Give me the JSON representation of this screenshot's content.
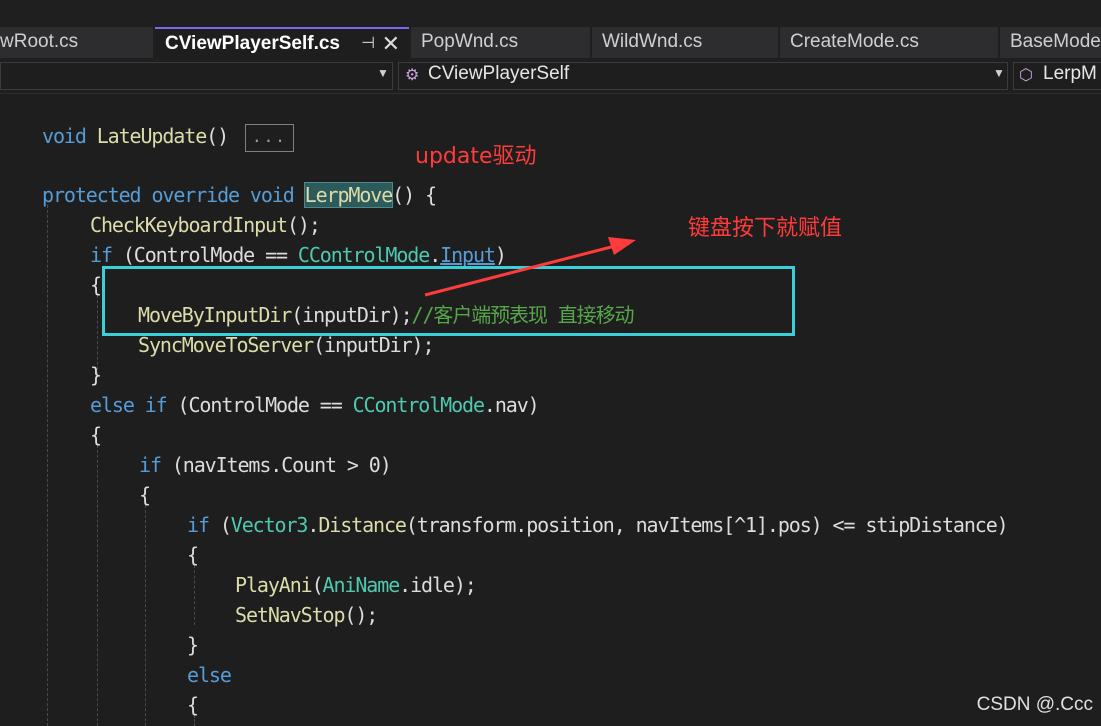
{
  "tabs": [
    {
      "label": "wRoot.cs"
    },
    {
      "label": "CViewPlayerSelf.cs",
      "pin": "⊣",
      "close": "✕"
    },
    {
      "label": "PopWnd.cs"
    },
    {
      "label": "WildWnd.cs"
    },
    {
      "label": "CreateMode.cs"
    },
    {
      "label": "BaseMode"
    }
  ],
  "navbar": {
    "class_label": "CViewPlayerSelf",
    "member_label": "LerpM"
  },
  "code": {
    "l1_kw": "void",
    "l1_fn": "LateUpdate",
    "l1_paren": "()",
    "l1_collapsed": "...",
    "l2_protected": "protected",
    "l2_override": "override",
    "l2_void": "void",
    "l2_fn": "LerpMove",
    "l2_paren": "()",
    "l2_brace": "{",
    "l3_fn": "CheckKeyboardInput",
    "l3_rest": "();",
    "l4_if": "if",
    "l4_a": " (ControlMode == ",
    "l4_type": "CControlMode",
    "l4_dot": ".",
    "l4_member": "Input",
    "l4_close": ")",
    "l5": "{",
    "l6_fn": "MoveByInputDir",
    "l6_rest": "(inputDir);",
    "l6_comment": "//客户端预表现 直接移动",
    "l7_fn": "SyncMoveToServer",
    "l7_rest": "(inputDir);",
    "l8": "}",
    "l9_else": "else",
    "l9_if": "if",
    "l9_a": " (ControlMode == ",
    "l9_type": "CControlMode",
    "l9_b": ".nav)",
    "l10": "{",
    "l11_if": "if",
    "l11_rest": " (navItems.Count > 0)",
    "l12": "{",
    "l13_if": "if",
    "l13_type": "Vector3",
    "l13_a": ".",
    "l13_fn": "Distance",
    "l13_b": "(transform.position, navItems[^1].pos) <= stipDistance)",
    "l14": "{",
    "l15_fn": "PlayAni",
    "l15_open": "(",
    "l15_type": "AniName",
    "l15_rest": ".idle);",
    "l16_fn": "SetNavStop",
    "l16_rest": "();",
    "l17": "}",
    "l18_else": "else",
    "l19": "{"
  },
  "annotations": {
    "update_note": "update驱动",
    "keyboard_note": "键盘按下就赋值",
    "arrow_color": "#ff3b3b",
    "box_color": "#39d0d8"
  },
  "watermark": "CSDN @.Ccc"
}
